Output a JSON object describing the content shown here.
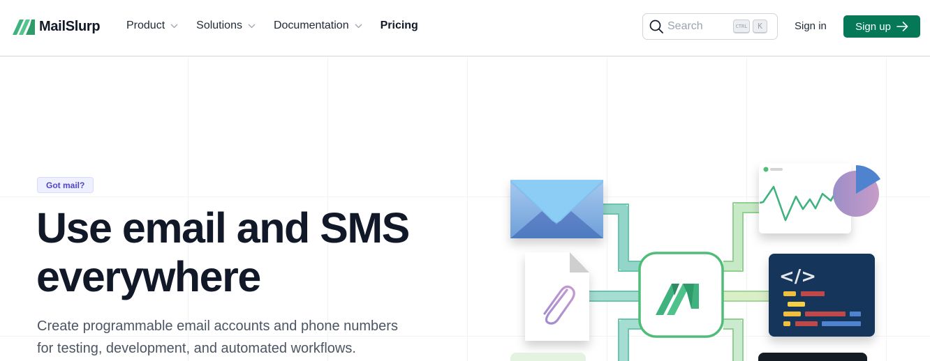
{
  "header": {
    "brand": "MailSlurp",
    "nav": [
      {
        "label": "Product",
        "has_dropdown": true
      },
      {
        "label": "Solutions",
        "has_dropdown": true
      },
      {
        "label": "Documentation",
        "has_dropdown": true
      },
      {
        "label": "Pricing",
        "has_dropdown": false
      }
    ],
    "search": {
      "placeholder": "Search",
      "shortcut_modifier": "CTRL",
      "shortcut_key": "K"
    },
    "sign_in_label": "Sign in",
    "sign_up_label": "Sign up"
  },
  "hero": {
    "badge": "Got mail?",
    "title_line1": "Use email and SMS",
    "title_line2": "everywhere",
    "subtitle_line1": "Create programmable email accounts and phone numbers",
    "subtitle_line2": "for testing, development, and automated workflows."
  },
  "illustration": {
    "code_symbol": "</>",
    "icons": [
      "envelope-icon",
      "attachment-file-icon",
      "mailslurp-hub-icon",
      "analytics-chart-icon",
      "code-editor-icon"
    ]
  },
  "colors": {
    "brand_green": "#047857",
    "logo_green": "#3fb27f",
    "badge_text": "#4f46c5",
    "badge_bg": "#eef0ff",
    "code_bg": "#12365a"
  }
}
